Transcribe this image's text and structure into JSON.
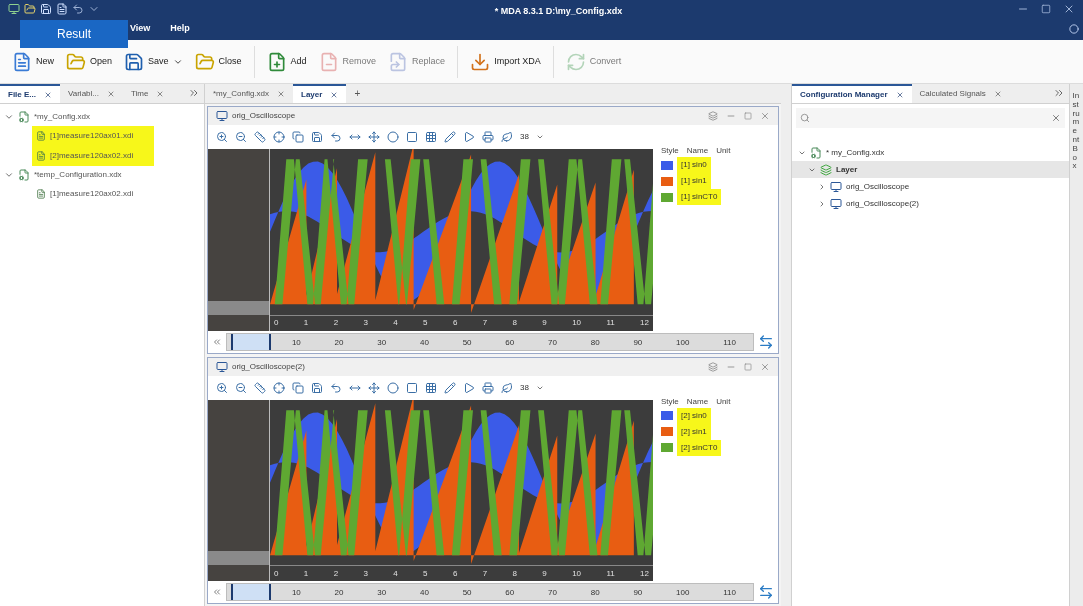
{
  "window": {
    "title": "* MDA 8.3.1 D:\\my_Config.xdx"
  },
  "result_button": "Result",
  "menu": [
    "View",
    "Help"
  ],
  "toolbar": [
    {
      "label": "New",
      "kind": "new",
      "disabled": false,
      "dropdown": false
    },
    {
      "label": "Open",
      "kind": "folder",
      "disabled": false,
      "dropdown": false
    },
    {
      "label": "Save",
      "kind": "save",
      "disabled": false,
      "dropdown": true
    },
    {
      "label": "Close",
      "kind": "folder",
      "disabled": false,
      "dropdown": false,
      "group_end": true
    },
    {
      "label": "Add",
      "kind": "add",
      "disabled": false,
      "dropdown": false
    },
    {
      "label": "Remove",
      "kind": "remove",
      "disabled": true,
      "dropdown": false
    },
    {
      "label": "Replace",
      "kind": "replace",
      "disabled": true,
      "dropdown": false,
      "group_end": true
    },
    {
      "label": "Import XDA",
      "kind": "import",
      "disabled": false,
      "dropdown": false,
      "group_end": true
    },
    {
      "label": "Convert",
      "kind": "convert",
      "disabled": true,
      "dropdown": false
    }
  ],
  "left_panel": {
    "tabs": [
      {
        "label": "File E...",
        "selected": true
      },
      {
        "label": "Variabl...",
        "selected": false
      },
      {
        "label": "Time",
        "selected": false
      }
    ],
    "tree": [
      {
        "label": "*my_Config.xdx",
        "expanded": true,
        "children": [
          {
            "label": "[1]measure120ax01.xdi",
            "highlighted": true
          },
          {
            "label": "[2]measure120ax02.xdi",
            "highlighted": true
          }
        ]
      },
      {
        "label": "*temp_Configuration.xdx",
        "expanded": true,
        "children": [
          {
            "label": "[1]measure120ax02.xdi",
            "highlighted": false
          }
        ]
      }
    ]
  },
  "center": {
    "tabs": [
      {
        "label": "*my_Config.xdx",
        "selected": false
      },
      {
        "label": "Layer",
        "selected": true
      }
    ],
    "add_tab": "+",
    "scopes": [
      {
        "title": "orig_Oscilloscope",
        "zoom": "38",
        "legend_columns": [
          "Style",
          "Name",
          "Unit"
        ],
        "signals": [
          {
            "name": "[1] sin0",
            "color": "#3b5be8",
            "highlighted": true
          },
          {
            "name": "[1] sin1",
            "color": "#e85d12",
            "highlighted": true
          },
          {
            "name": "[1] sinCT0",
            "color": "#5fa832",
            "highlighted": true
          }
        ],
        "x_axis_labels": [
          "0",
          "1",
          "2",
          "3",
          "4",
          "5",
          "6",
          "7",
          "8",
          "9",
          "10",
          "11",
          "12"
        ],
        "ruler_labels": [
          "10",
          "20",
          "30",
          "40",
          "50",
          "60",
          "70",
          "80",
          "90",
          "100",
          "110"
        ]
      },
      {
        "title": "orig_Oscilloscope(2)",
        "zoom": "38",
        "legend_columns": [
          "Style",
          "Name",
          "Unit"
        ],
        "signals": [
          {
            "name": "[2] sin0",
            "color": "#3b5be8",
            "highlighted": true
          },
          {
            "name": "[2] sin1",
            "color": "#e85d12",
            "highlighted": true
          },
          {
            "name": "[2] sinCT0",
            "color": "#5fa832",
            "highlighted": true
          }
        ],
        "x_axis_labels": [
          "0",
          "1",
          "2",
          "3",
          "4",
          "5",
          "6",
          "7",
          "8",
          "9",
          "10",
          "11",
          "12"
        ],
        "ruler_labels": [
          "10",
          "20",
          "30",
          "40",
          "50",
          "60",
          "70",
          "80",
          "90",
          "100",
          "110"
        ]
      }
    ]
  },
  "right_panel": {
    "tabs": [
      {
        "label": "Configuration Manager",
        "selected": true
      },
      {
        "label": "Calculated Signals",
        "selected": false
      }
    ],
    "tree": [
      {
        "label": "* my_Config.xdx",
        "kind": "config",
        "selected": false,
        "children": [
          {
            "label": "Layer",
            "kind": "layer",
            "selected": true,
            "children": [
              {
                "label": "orig_Oscilloscope",
                "kind": "scope",
                "selected": false
              },
              {
                "label": "orig_Oscilloscope(2)",
                "kind": "scope",
                "selected": false
              }
            ]
          }
        ]
      }
    ]
  },
  "side_strip": "Instrument Box"
}
